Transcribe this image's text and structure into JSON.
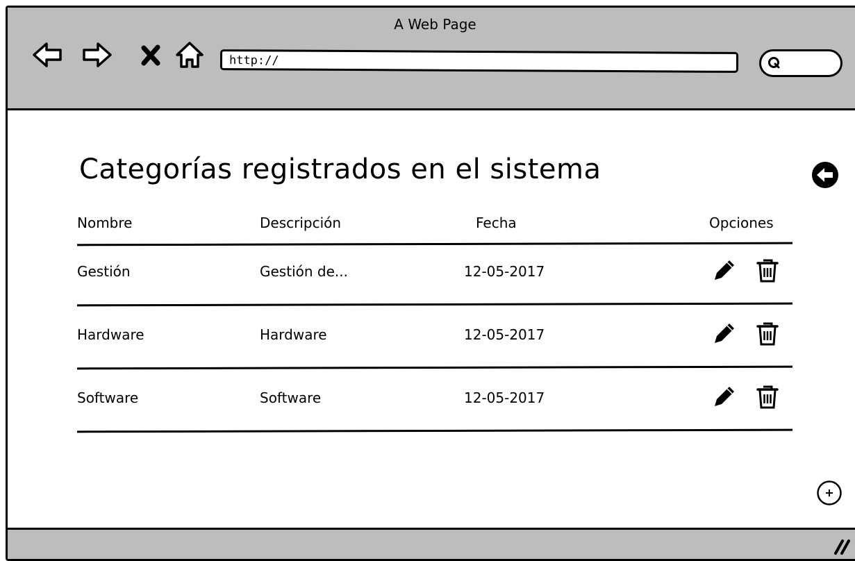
{
  "window": {
    "title": "A Web Page"
  },
  "browser": {
    "url": "http://",
    "nav_icons": [
      "back-arrow-icon",
      "forward-arrow-icon",
      "stop-icon",
      "home-icon"
    ],
    "search_icon": "search-icon"
  },
  "page": {
    "title": "Categorías registrados en el sistema",
    "back_icon": "back-circle-icon",
    "add_icon": "add-circle-icon"
  },
  "table": {
    "headers": {
      "name": "Nombre",
      "description": "Descripción",
      "date": "Fecha",
      "options": "Opciones"
    },
    "rows": [
      {
        "name": "Gestión",
        "description": "Gestión de...",
        "date": "12-05-2017"
      },
      {
        "name": "Hardware",
        "description": "Hardware",
        "date": "12-05-2017"
      },
      {
        "name": "Software",
        "description": "Software",
        "date": "12-05-2017"
      }
    ],
    "row_icons": [
      "pencil-icon",
      "trash-icon"
    ]
  }
}
